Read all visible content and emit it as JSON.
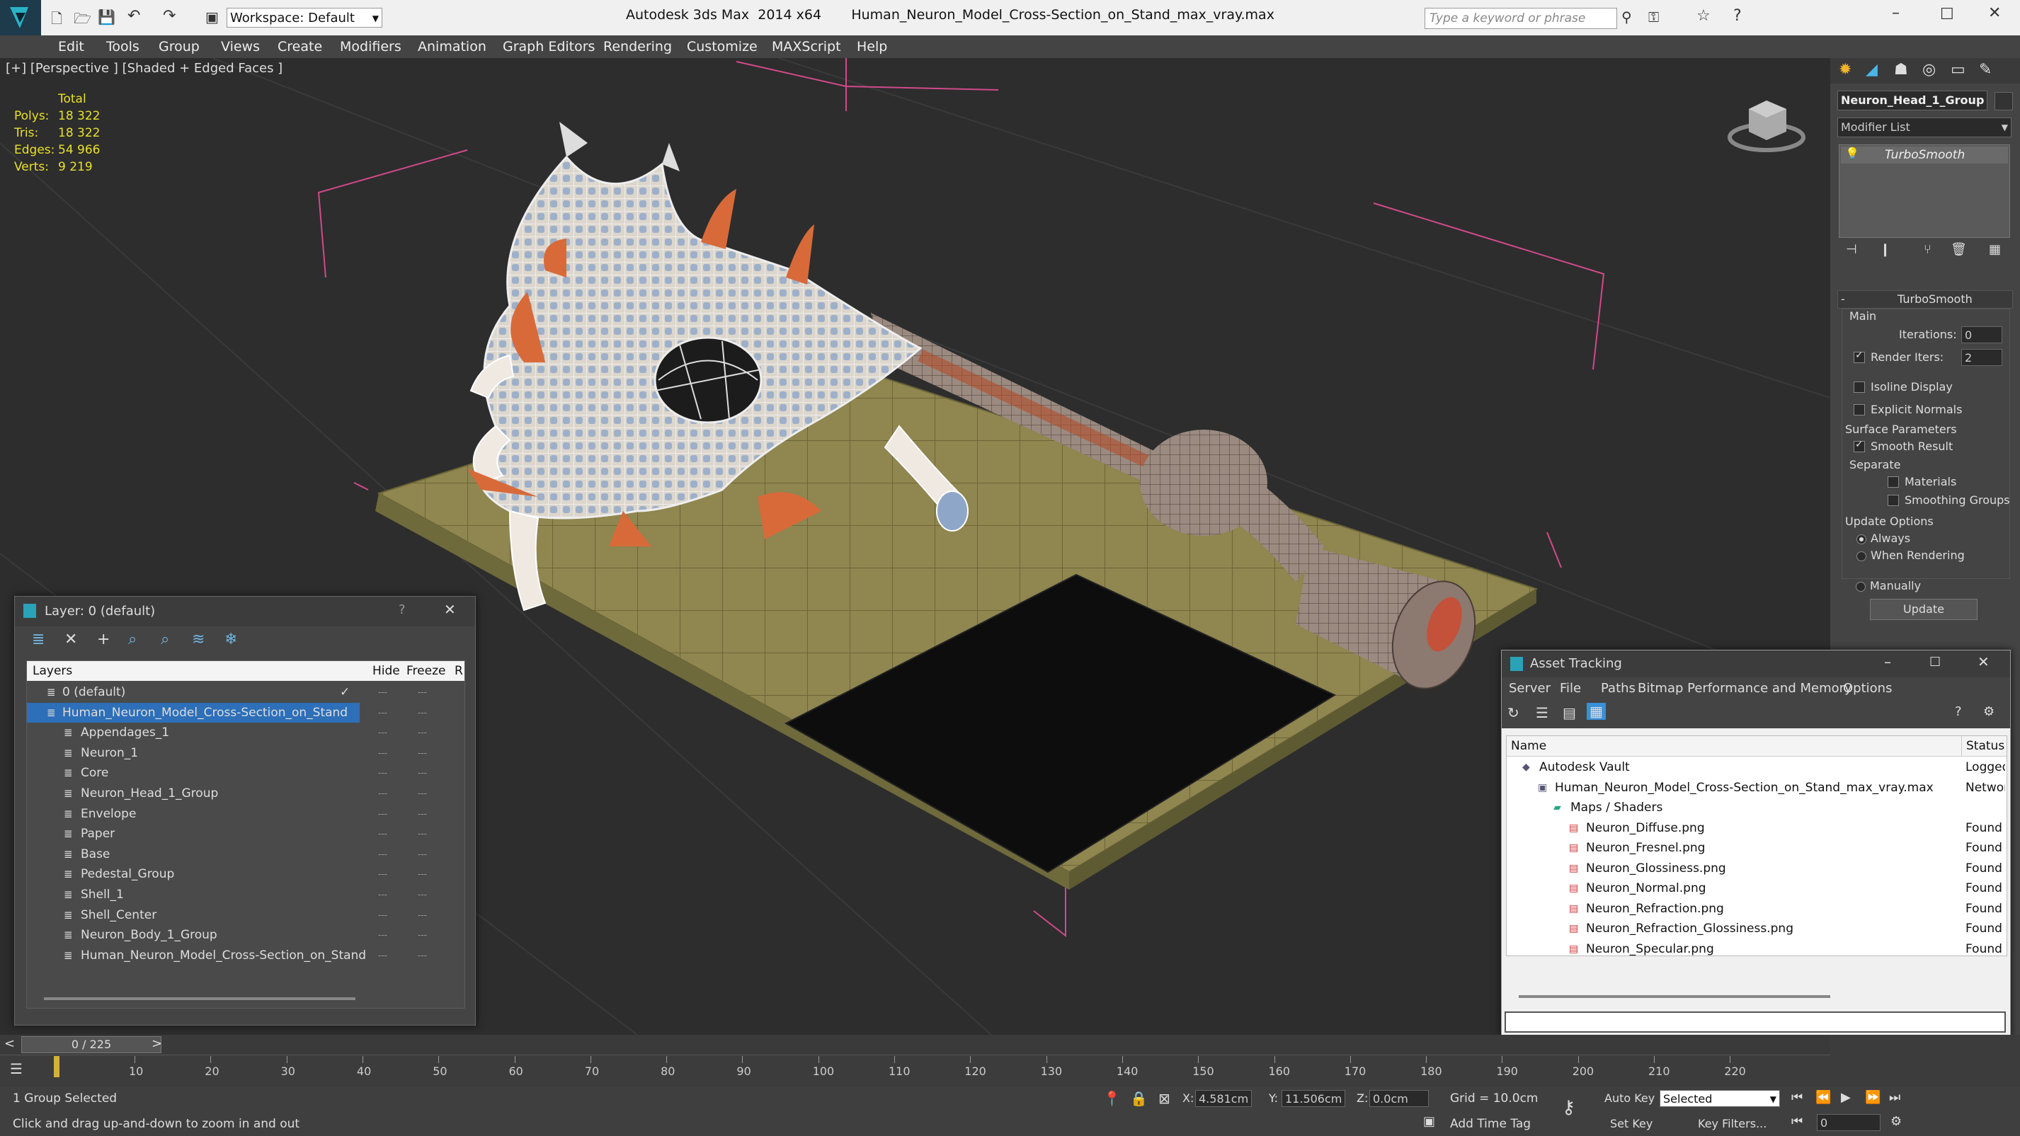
{
  "titlebar": {
    "workspace_label": "Workspace: Default",
    "title": "Autodesk 3ds Max  2014 x64       Human_Neuron_Model_Cross-Section_on_Stand_max_vray.max",
    "search_placeholder": "Type a keyword or phrase"
  },
  "menu": [
    "Edit",
    "Tools",
    "Group",
    "Views",
    "Create",
    "Modifiers",
    "Animation",
    "Graph Editors",
    "Rendering",
    "Customize",
    "MAXScript",
    "Help"
  ],
  "viewport": {
    "label": "[+] [Perspective ] [Shaded + Edged Faces ]",
    "stats": {
      "total_label": "Total",
      "polys_label": "Polys:",
      "polys": "18 322",
      "tris_label": "Tris:",
      "tris": "18 322",
      "edges_label": "Edges:",
      "edges": "54 966",
      "verts_label": "Verts:",
      "verts": "9 219"
    }
  },
  "cmdpanel": {
    "object_name": "Neuron_Head_1_Group",
    "modifier_list": "Modifier List",
    "stack_item": "TurboSmooth",
    "rollout_title": "TurboSmooth",
    "main_label": "Main",
    "iterations_label": "Iterations:",
    "iterations": "0",
    "render_iters_label": "Render Iters:",
    "render_iters": "2",
    "isoline": "Isoline Display",
    "explicit": "Explicit Normals",
    "surface_params": "Surface Parameters",
    "smooth_result": "Smooth Result",
    "separate": "Separate",
    "materials": "Materials",
    "smoothing_groups": "Smoothing Groups",
    "update_options": "Update Options",
    "always": "Always",
    "when_rendering": "When Rendering",
    "manually": "Manually",
    "update_button": "Update"
  },
  "layers": {
    "title": "Layer: 0 (default)",
    "col_layers": "Layers",
    "col_hide": "Hide",
    "col_freeze": "Freeze",
    "col_r": "R",
    "rows": [
      {
        "name": "0 (default)",
        "level": 0
      },
      {
        "name": "Human_Neuron_Model_Cross-Section_on_Stand",
        "level": 0,
        "selected": true
      },
      {
        "name": "Appendages_1",
        "level": 1
      },
      {
        "name": "Neuron_1",
        "level": 1
      },
      {
        "name": "Core",
        "level": 1
      },
      {
        "name": "Neuron_Head_1_Group",
        "level": 1
      },
      {
        "name": "Envelope",
        "level": 1
      },
      {
        "name": "Paper",
        "level": 1
      },
      {
        "name": "Base",
        "level": 1
      },
      {
        "name": "Pedestal_Group",
        "level": 1
      },
      {
        "name": "Shell_1",
        "level": 1
      },
      {
        "name": "Shell_Center",
        "level": 1
      },
      {
        "name": "Neuron_Body_1_Group",
        "level": 1
      },
      {
        "name": "Human_Neuron_Model_Cross-Section_on_Stand",
        "level": 1
      }
    ]
  },
  "asset": {
    "title": "Asset Tracking",
    "menu": [
      "Server",
      "File",
      "Paths",
      "Bitmap Performance and Memory",
      "Options"
    ],
    "col_name": "Name",
    "col_status": "Status",
    "rows": [
      {
        "name": "Autodesk Vault",
        "status": "Logged O",
        "level": 1
      },
      {
        "name": "Human_Neuron_Model_Cross-Section_on_Stand_max_vray.max",
        "status": "Network F",
        "level": 2
      },
      {
        "name": "Maps / Shaders",
        "status": "",
        "level": 3
      },
      {
        "name": "Neuron_Diffuse.png",
        "status": "Found",
        "level": 4
      },
      {
        "name": "Neuron_Fresnel.png",
        "status": "Found",
        "level": 4
      },
      {
        "name": "Neuron_Glossiness.png",
        "status": "Found",
        "level": 4
      },
      {
        "name": "Neuron_Normal.png",
        "status": "Found",
        "level": 4
      },
      {
        "name": "Neuron_Refraction.png",
        "status": "Found",
        "level": 4
      },
      {
        "name": "Neuron_Refraction_Glossiness.png",
        "status": "Found",
        "level": 4
      },
      {
        "name": "Neuron_Specular.png",
        "status": "Found",
        "level": 4
      }
    ]
  },
  "timeline": {
    "frame_label": "0 / 225",
    "ticks": [
      "10",
      "20",
      "30",
      "40",
      "50",
      "60",
      "70",
      "80",
      "90",
      "100",
      "110",
      "120",
      "130",
      "140",
      "150",
      "160",
      "170",
      "180",
      "190",
      "200",
      "210",
      "220"
    ]
  },
  "status": {
    "selected_text": "1 Group Selected",
    "hint_text": "Click and drag up-and-down to zoom in and out",
    "x_label": "X:",
    "x_value": "4.581cm",
    "y_label": "Y:",
    "y_value": "11.506cm",
    "z_label": "Z:",
    "z_value": "0.0cm",
    "grid": "Grid = 10.0cm",
    "auto_key": "Auto Key",
    "auto_key_mode": "Selected",
    "set_key": "Set Key",
    "key_filters": "Key Filters...",
    "add_time_tag": "Add Time Tag",
    "frame_value": "0"
  }
}
